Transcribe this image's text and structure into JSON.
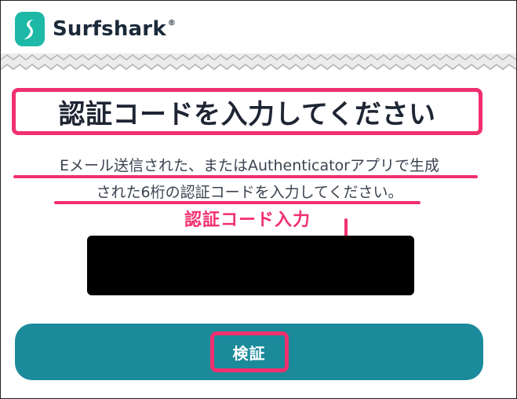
{
  "brand": {
    "name": "Surfshark",
    "trademark": "®",
    "accent_color": "#1eb8a7"
  },
  "page": {
    "title": "認証コードを入力してください",
    "description_line1": "Eメール送信された、またはAuthenticatorアプリで生成",
    "description_line2": "された6桁の認証コードを入力してください。"
  },
  "annotation": {
    "code_label": "認証コード入力",
    "highlight_color": "#f0306e"
  },
  "form": {
    "code_input_value": "",
    "verify_label": "検証",
    "button_color": "#1b8a9b"
  },
  "icons": {
    "logo": "surfshark-logo-icon",
    "arrow": "arrow-down-icon"
  }
}
